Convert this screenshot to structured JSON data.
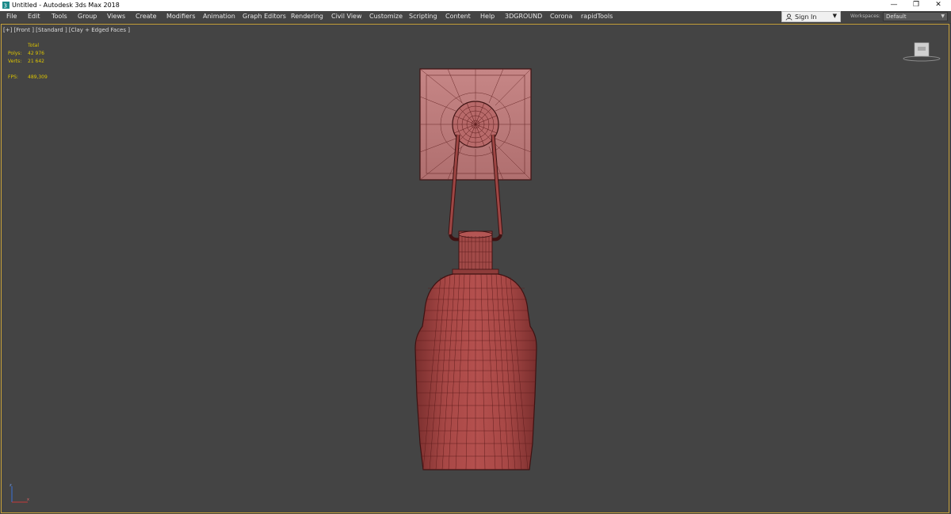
{
  "window": {
    "title": "Untitled - Autodesk 3ds Max 2018",
    "controls": [
      "—",
      "❐",
      "✕"
    ]
  },
  "menu": {
    "items": [
      "File",
      "Edit",
      "Tools",
      "Group",
      "Views",
      "Create",
      "Modifiers",
      "Animation",
      "Graph Editors",
      "Rendering",
      "Civil View",
      "Customize",
      "Scripting",
      "Content",
      "Help",
      "3DGROUND",
      "Corona",
      "rapidTools"
    ]
  },
  "account": {
    "sign_in_label": "Sign In"
  },
  "workspaces": {
    "label": "Workspaces:",
    "value": "Default"
  },
  "viewport": {
    "label": "[+] [Front ] [Standard ] [Clay + Edged Faces ]",
    "stats": {
      "header": "Total",
      "polys_label": "Polys:",
      "polys_value": "42 976",
      "verts_label": "Verts:",
      "verts_value": "21 642",
      "fps_label": "FPS:",
      "fps_value": "489,309"
    },
    "model_color": "#a24a48",
    "wire_color": "#5a1a1a"
  }
}
